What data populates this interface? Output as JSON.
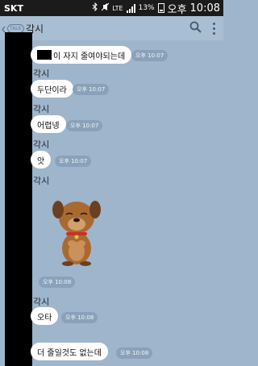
{
  "status": {
    "carrier": "SKT",
    "network": "LTE",
    "battery": "13%",
    "ampm": "오후",
    "time": "10:08"
  },
  "header": {
    "badge": "TALK",
    "title": "각시"
  },
  "messages": [
    {
      "sender": "",
      "text": "이 자지 줄여야되는데",
      "time": "오후 10:07"
    },
    {
      "sender": "각시",
      "text": "두단이라",
      "time": "오후 10:07"
    },
    {
      "sender": "각시",
      "text": "어렵넹",
      "time": "오후 10:07"
    },
    {
      "sender": "각시",
      "text": "앗",
      "time": "오후 10:07"
    },
    {
      "sender": "각시",
      "text": "",
      "time": "오후 10:08"
    },
    {
      "sender": "각시",
      "text": "오타",
      "time": "오후 10:08"
    },
    {
      "sender": "",
      "text": "더 줄일것도 없는데",
      "time": "오후 10:08"
    }
  ],
  "colors": {
    "chat_bg": "#9fb5cc",
    "bubble": "#ffffff",
    "statusbar": "#1b1b1b"
  }
}
